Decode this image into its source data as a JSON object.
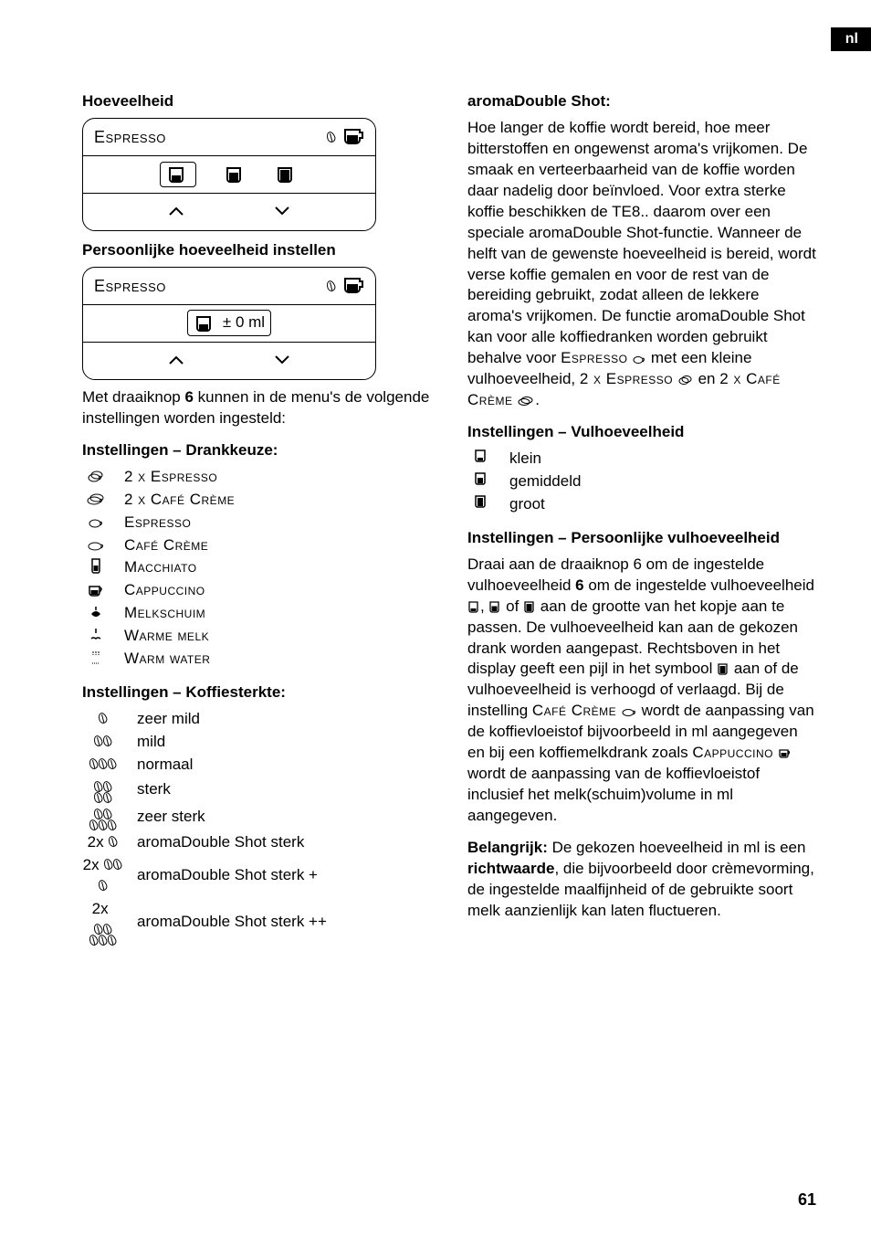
{
  "lang_tag": "nl",
  "page_number": "61",
  "left": {
    "h_amount": "Hoeveelheid",
    "panel1_title": "Espresso",
    "h_personal": "Persoonlijke hoeveelheid instellen",
    "panel2_title": "Espresso",
    "panel2_value": "± 0 ml",
    "p_intro": "Met draaiknop 6 kunnen in de menu's de volgende instellingen worden ingesteld:",
    "h_drank": "Instellingen – Drankkeuze:",
    "drinks": [
      "2 x Espresso",
      "2 x Café Crème",
      "Espresso",
      "Café Crème",
      "Macchiato",
      "Cappuccino",
      "Melkschuim",
      "Warme melk",
      "Warm water"
    ],
    "h_strength": "Instellingen – Koffiesterkte:",
    "strengths": [
      "zeer mild",
      "mild",
      "normaal",
      "sterk",
      "zeer sterk",
      "aromaDouble Shot sterk",
      "aromaDouble Shot sterk +",
      "aromaDouble Shot sterk ++"
    ],
    "strength_prefix": [
      "",
      "",
      "",
      "",
      "",
      "2x",
      "2x",
      "2x"
    ]
  },
  "right": {
    "h_ads": "aromaDouble Shot:",
    "p_ads": "Hoe langer de koffie wordt bereid, hoe meer bitterstoffen en ongewenst aroma's vrijkomen. De smaak en verteerbaarheid van de koffie worden daar nadelig door beïnvloed. Voor extra sterke koffie beschikken de TE8.. daarom over een speciale aromaDouble Shot-functie. Wanneer de helft van de gewenste hoeveelheid is bereid, wordt verse koffie gemalen en voor de rest van de bereiding gebruikt, zodat alleen de lekkere aroma's vrijkomen. De functie aromaDouble Shot kan voor alle koffiedranken worden gebruikt behalve voor ",
    "p_ads_tail1": " met een kleine vulhoeveelheid, ",
    "p_ads_tail2": " en ",
    "p_ads_tail_end": ".",
    "sc_espresso": "Espresso",
    "sc_2xespresso": "2 x Espresso",
    "sc_2xcafe": "2 x Café Crème",
    "h_fill": "Instellingen – Vulhoeveelheid",
    "fill": [
      "klein",
      "gemiddeld",
      "groot"
    ],
    "h_personal": "Instellingen – Persoonlijke vulhoeveelheid",
    "p_personal_a": "Draai aan de draaiknop 6 om de ingestelde vulhoeveelheid ",
    "p_personal_b": ", ",
    "p_personal_c": " of ",
    "p_personal_d": " aan de grootte van het kopje aan te passen. De vulhoeveelheid kan aan de gekozen drank worden aangepast. Rechtsboven in het display geeft een pijl in het symbool ",
    "p_personal_e": " aan of de vulhoeveelheid is verhoogd of verlaagd. Bij de instelling ",
    "sc_cafecreme": "Café Crème",
    "p_personal_f": " wordt de aanpassing van de koffievloeistof bijvoorbeeld in ml aangegeven en bij een koffiemelkdrank zoals ",
    "sc_cappuccino": "Cappuccino",
    "p_personal_g": " wordt de aanpassing van de koffievloeistof inclusief het melk(schuim)volume in ml aangegeven.",
    "p_important_lead": "Belangrijk:",
    "p_important": " De gekozen hoeveelheid in ml is een ",
    "p_important_bold": "richtwaarde",
    "p_important_tail": ", die bijvoorbeeld door crèmevorming, de ingestelde maalfijnheid of de gebruikte soort melk aanzienlijk kan laten fluctueren."
  }
}
